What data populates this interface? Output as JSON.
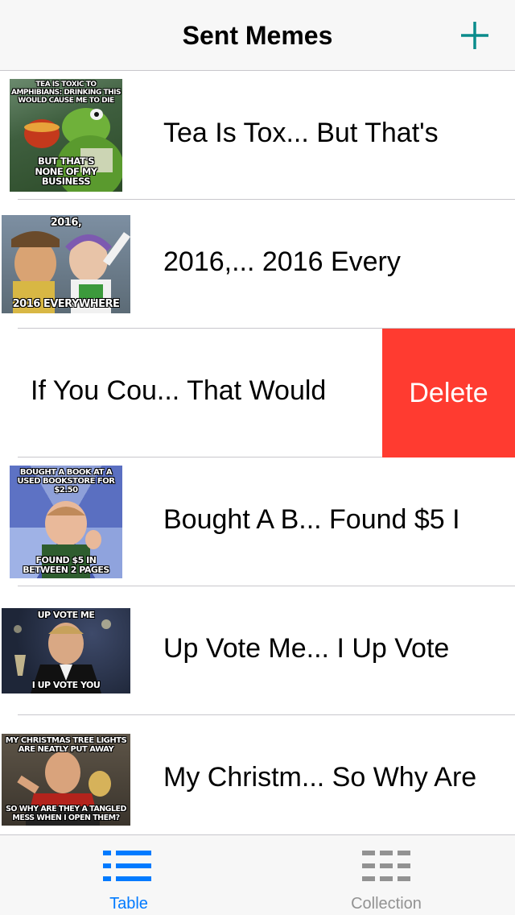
{
  "nav": {
    "title": "Sent Memes",
    "add_icon": "plus-icon"
  },
  "colors": {
    "accent": "#007aff",
    "teal": "#0a8c8c",
    "delete": "#ff3b30",
    "inactive": "#929292"
  },
  "memes": [
    {
      "label": "Tea Is Tox... But That's",
      "top_text": "Tea is toxic to amphibians: drinking this would cause me to die",
      "bottom_text": "But that's none of my business"
    },
    {
      "label": "2016,... 2016 Every",
      "top_text": "2016,",
      "bottom_text": "2016 everywhere"
    },
    {
      "label": "If You Cou... That Would",
      "delete_label": "Delete"
    },
    {
      "label": "Bought A B... Found $5 I",
      "top_text": "Bought a book at a used bookstore for $2.50",
      "bottom_text": "Found $5 in between 2 pages"
    },
    {
      "label": "Up Vote Me... I Up Vote",
      "top_text": "Up vote me",
      "bottom_text": "I up vote you"
    },
    {
      "label": "My Christm... So Why Are",
      "top_text": "My Christmas tree lights are neatly put away",
      "bottom_text": "So why are they a tangled mess when I open them?"
    }
  ],
  "tabs": [
    {
      "label": "Table",
      "icon": "list-icon",
      "active": true
    },
    {
      "label": "Collection",
      "icon": "grid-icon",
      "active": false
    }
  ]
}
